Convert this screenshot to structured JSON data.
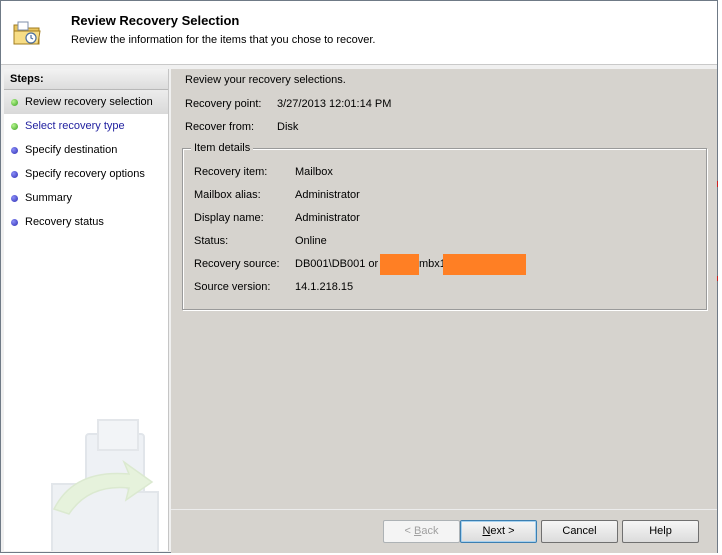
{
  "header": {
    "title": "Review Recovery Selection",
    "subtitle": "Review the information for the items that you chose to recover."
  },
  "steps": {
    "heading": "Steps:",
    "items": [
      {
        "label": "Review recovery selection",
        "state": "active"
      },
      {
        "label": "Select recovery type",
        "state": "link"
      },
      {
        "label": "Specify destination",
        "state": "pending"
      },
      {
        "label": "Specify recovery options",
        "state": "pending"
      },
      {
        "label": "Summary",
        "state": "pending"
      },
      {
        "label": "Recovery status",
        "state": "pending"
      }
    ]
  },
  "content": {
    "intro": "Review your recovery selections.",
    "recovery_point_label": "Recovery point:",
    "recovery_point_value": "3/27/2013 12:01:14 PM",
    "recover_from_label": "Recover from:",
    "recover_from_value": "Disk",
    "item_details": {
      "legend": "Item details",
      "rows": [
        {
          "label": "Recovery item:",
          "value": "Mailbox"
        },
        {
          "label": "Mailbox alias:",
          "value": "Administrator"
        },
        {
          "label": "Display name:",
          "value": "Administrator"
        },
        {
          "label": "Status:",
          "value": "Online"
        },
        {
          "label": "Recovery source:",
          "value_prefix": "DB001\\DB001 or",
          "value_mid": "mbx1"
        },
        {
          "label": "Source version:",
          "value": "14.1.218.15"
        }
      ]
    }
  },
  "buttons": {
    "back": {
      "pre": "< ",
      "key": "B",
      "rest": "ack"
    },
    "next": {
      "key": "N",
      "rest": "ext >"
    },
    "cancel": "Cancel",
    "help": "Help"
  },
  "colors": {
    "redaction": "#ff7f24",
    "content_bg": "#d6d3ce",
    "step_active_dot": "#38a11f",
    "step_pending_dot": "#2d2eb2"
  }
}
